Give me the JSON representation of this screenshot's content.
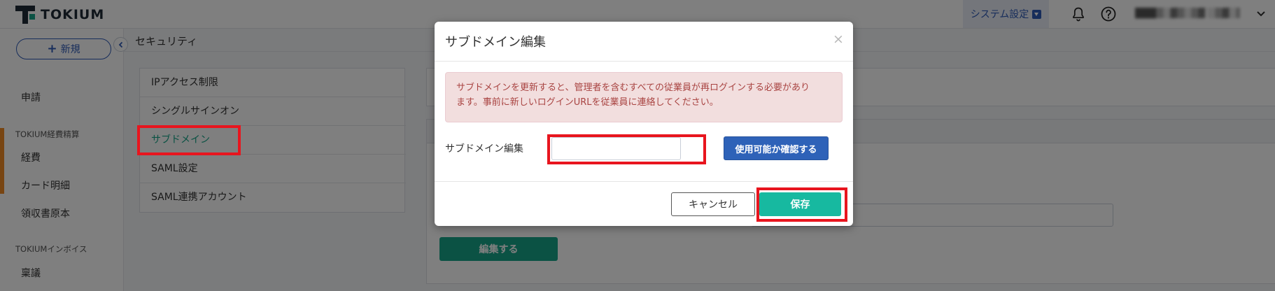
{
  "header": {
    "logo_text": "TOKIUM",
    "system_settings_label": "システム設定",
    "user_name": "███▒░▓▒░▒▓ ░▒▓░▒▒░",
    "icons": [
      "bell-icon",
      "help-icon",
      "chevron-down-icon"
    ]
  },
  "sidebar": {
    "new_button_label": "新規",
    "items": [
      {
        "label": "申請"
      },
      {
        "section": "TOKIUM経費精算"
      },
      {
        "label": "経費"
      },
      {
        "label": "カード明細"
      },
      {
        "label": "領収書原本"
      },
      {
        "section": "TOKIUMインボイス"
      },
      {
        "label": "稟議"
      }
    ]
  },
  "main": {
    "page_title": "セキュリティ",
    "menu": [
      {
        "label": "IPアクセス制限"
      },
      {
        "label": "シングルサインオン"
      },
      {
        "label": "サブドメイン",
        "active": true
      },
      {
        "label": "SAML設定"
      },
      {
        "label": "SAML連携アカウント"
      }
    ],
    "edit_button_label": "編集する"
  },
  "modal": {
    "title": "サブドメイン編集",
    "close_symbol": "×",
    "alert_text": "サブドメインを更新すると、管理者を含むすべての従業員が再ログインする必要がありま す。事前に新しいログインURLを従業員に連絡してください。",
    "alert_line1": "サブドメインを更新すると、管理者を含むすべての従業員が再ログインする必要があり",
    "alert_line2": "ます。事前に新しいログインURLを従業員に連絡してください。",
    "field_label": "サブドメイン編集",
    "input_value": "",
    "input_placeholder": "",
    "check_button_label": "使用可能か確認する",
    "cancel_button_label": "キャンセル",
    "save_button_label": "保存"
  },
  "colors": {
    "brand_teal": "#17a589",
    "primary_blue": "#2e62b8",
    "alert_text": "#a94442",
    "alert_bg": "#f2dede",
    "highlight_red": "#e8151e"
  }
}
